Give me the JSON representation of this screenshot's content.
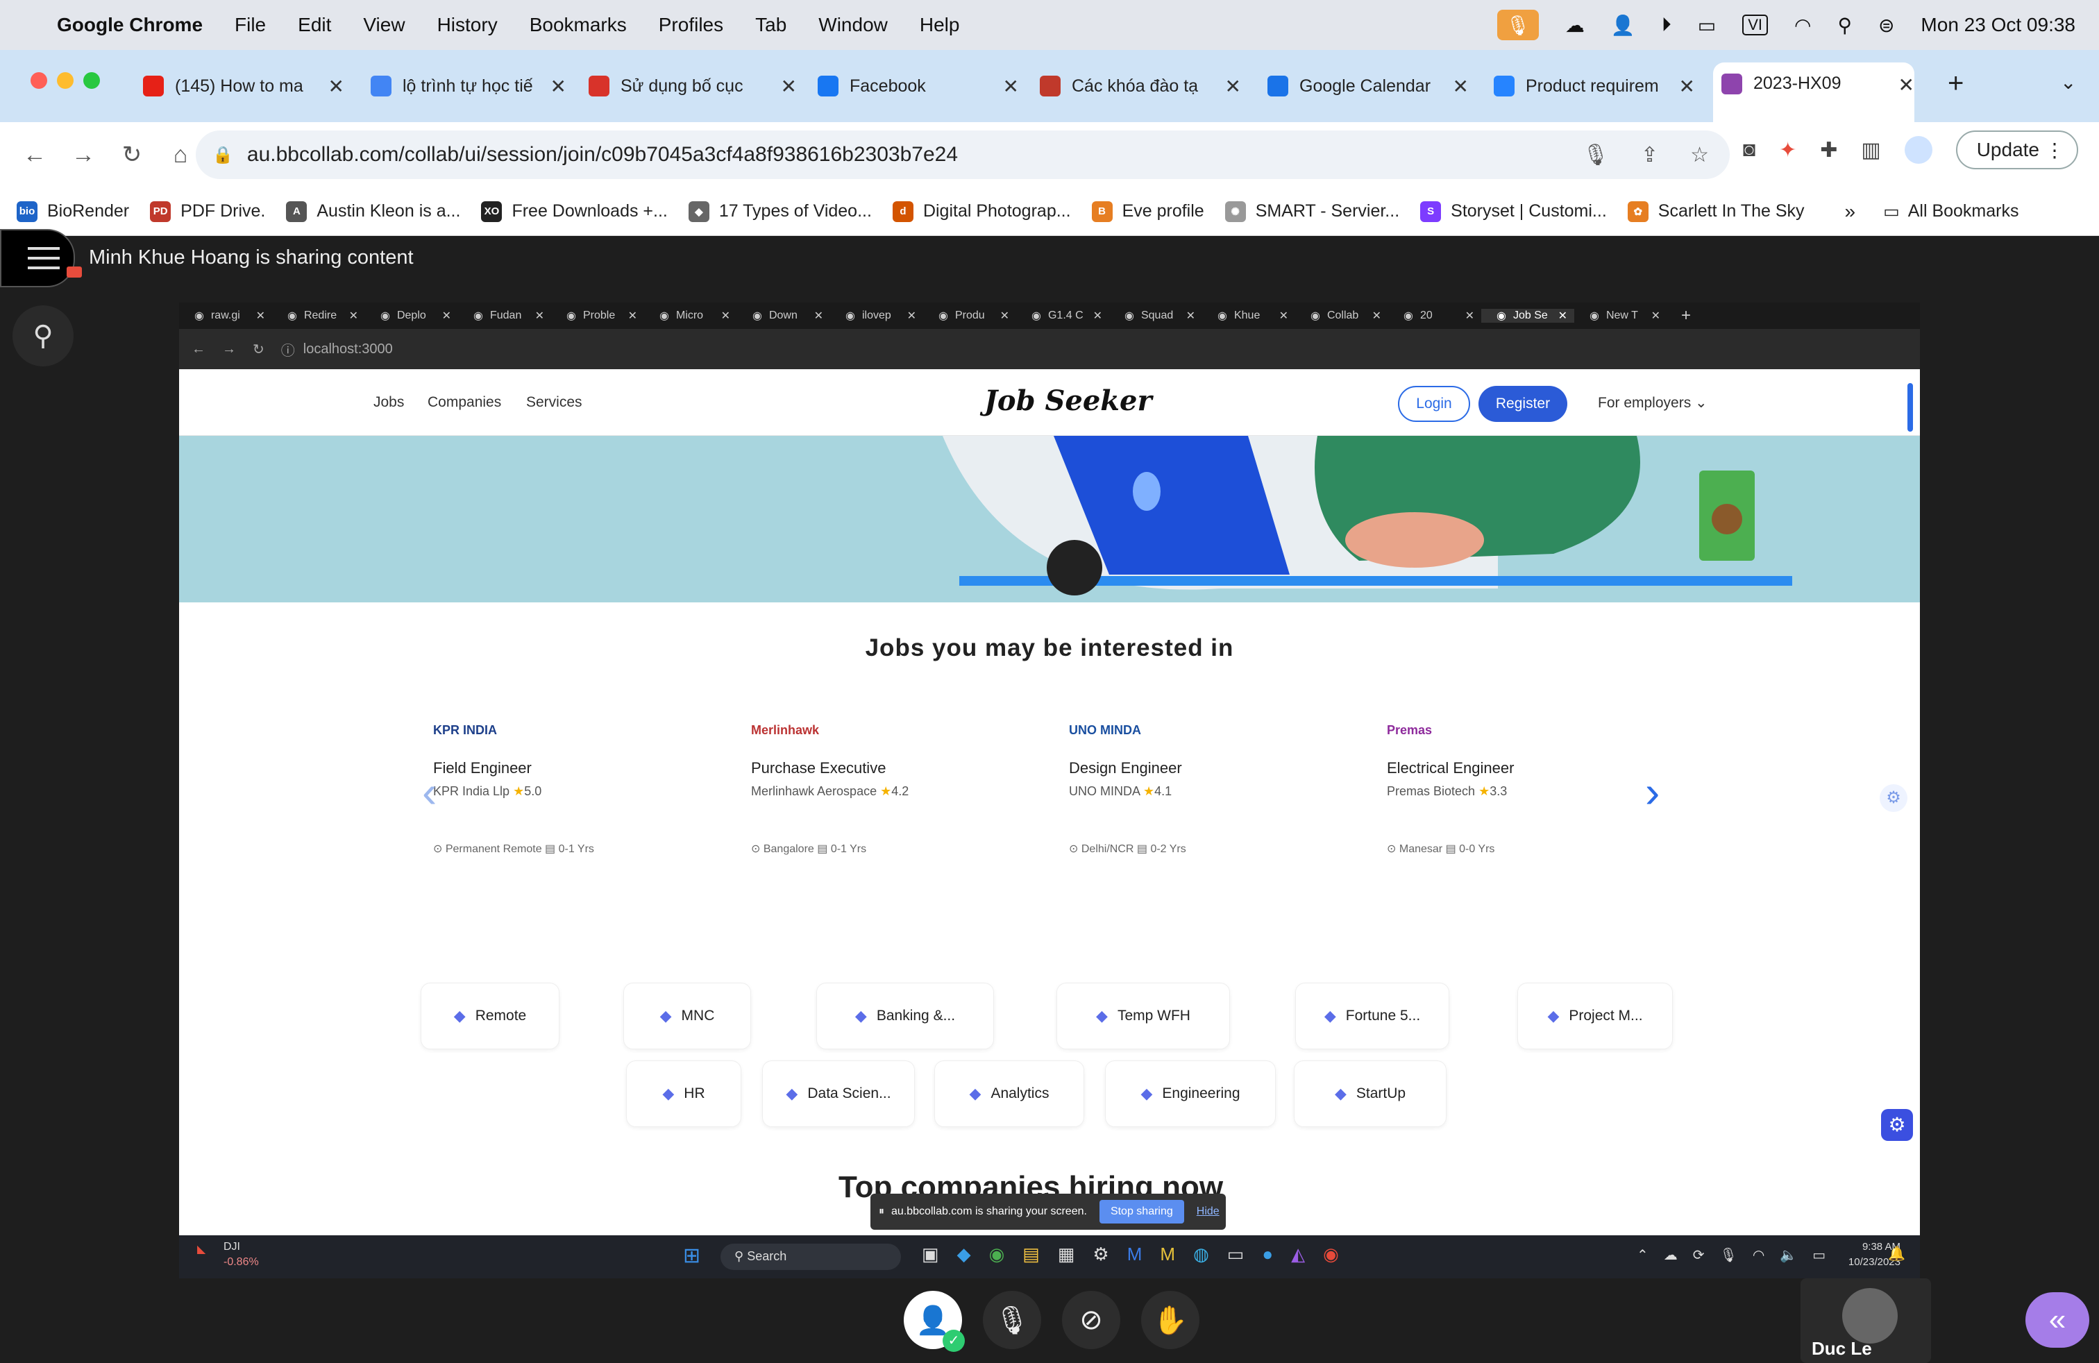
{
  "menubar": {
    "app": "Google Chrome",
    "items": [
      "File",
      "Edit",
      "View",
      "History",
      "Bookmarks",
      "Profiles",
      "Tab",
      "Window",
      "Help"
    ],
    "input_source": "VI",
    "datetime": "Mon 23 Oct  09:38"
  },
  "tabs": [
    {
      "label": "(145) How to ma",
      "icon": "youtube-icon",
      "color": "#e62117"
    },
    {
      "label": "lộ trình tự học tiế",
      "icon": "google-icon",
      "color": "#4285f4"
    },
    {
      "label": "Sử dụng bố cục",
      "icon": "t-icon",
      "color": "#d8332a"
    },
    {
      "label": "Facebook",
      "icon": "facebook-icon",
      "color": "#1877f2"
    },
    {
      "label": "Các khóa đào tạ",
      "icon": "course-icon",
      "color": "#c0392b"
    },
    {
      "label": "Google Calendar",
      "icon": "calendar-icon",
      "color": "#1a73e8"
    },
    {
      "label": "Product requirem",
      "icon": "confluence-icon",
      "color": "#2684ff"
    },
    {
      "label": "2023-HX09",
      "icon": "collab-icon",
      "color": "#8e44ad"
    }
  ],
  "toolbar": {
    "url": "au.bbcollab.com/collab/ui/session/join/c09b7045a3cf4a8f938616b2303b7e24",
    "update_label": "Update"
  },
  "bookmarks": [
    {
      "label": "BioRender",
      "color": "#1e64c8",
      "abbr": "bio"
    },
    {
      "label": "PDF Drive.",
      "color": "#c0392b",
      "abbr": "PD"
    },
    {
      "label": "Austin Kleon is a...",
      "color": "#555",
      "abbr": "A"
    },
    {
      "label": "Free Downloads +...",
      "color": "#222",
      "abbr": "XO"
    },
    {
      "label": "17 Types of Video...",
      "color": "#666",
      "abbr": "◆"
    },
    {
      "label": "Digital Photograp...",
      "color": "#d35400",
      "abbr": "d"
    },
    {
      "label": "Eve profile",
      "color": "#e67e22",
      "abbr": "B"
    },
    {
      "label": "SMART - Servier...",
      "color": "#999",
      "abbr": "✺"
    },
    {
      "label": "Storyset | Customi...",
      "color": "#7d3cff",
      "abbr": "S"
    },
    {
      "label": "Scarlett In The Sky",
      "color": "#e67e22",
      "abbr": "✿"
    }
  ],
  "bookmarks_more": "»",
  "all_bookmarks": "All Bookmarks",
  "collab": {
    "sharing_text": "Minh Khue Hoang is sharing content",
    "participant": "Duc Le"
  },
  "inner": {
    "tabs": [
      "raw.gi",
      "Redire",
      "Deplo",
      "Fudan",
      "Proble",
      "Micro",
      "Down",
      "ilovep",
      "Produ",
      "G1.4 C",
      "Squad",
      "Khue",
      "Collab",
      "20",
      "Job Se",
      "New T"
    ],
    "address": "localhost:3000",
    "nav": {
      "jobs": "Jobs",
      "companies": "Companies",
      "services": "Services",
      "logo": "Job Seeker",
      "login": "Login",
      "register": "Register",
      "employers": "For employers"
    },
    "jobs_title": "Jobs you may be interested in",
    "jobs": [
      {
        "logo": "KPR INDIA",
        "title": "Field Engineer",
        "company": "KPR India Llp",
        "rating": "5.0",
        "location": "Permanent Remote",
        "exp": "0-1 Yrs"
      },
      {
        "logo": "Merlinhawk",
        "title": "Purchase Executive",
        "company": "Merlinhawk Aerospace",
        "rating": "4.2",
        "location": "Bangalore",
        "exp": "0-1 Yrs"
      },
      {
        "logo": "UNO MINDA",
        "title": "Design Engineer",
        "company": "UNO MINDA",
        "rating": "4.1",
        "location": "Delhi/NCR",
        "exp": "0-2 Yrs"
      },
      {
        "logo": "Premas",
        "title": "Electrical Engineer",
        "company": "Premas Biotech",
        "rating": "3.3",
        "location": "Manesar",
        "exp": "0-0 Yrs"
      }
    ],
    "categories_row1": [
      "Remote",
      "MNC",
      "Banking &...",
      "Temp WFH",
      "Fortune 5...",
      "Project M..."
    ],
    "categories_row2": [
      "HR",
      "Data Scien...",
      "Analytics",
      "Engineering",
      "StartUp"
    ],
    "top_companies": "Top companies hiring now",
    "share_bar": {
      "text": "au.bbcollab.com is sharing your screen.",
      "stop": "Stop sharing",
      "hide": "Hide"
    },
    "taskbar": {
      "stock": "DJI",
      "stock_change": "-0.86%",
      "search": "Search",
      "time": "9:38 AM",
      "date": "10/23/2023"
    }
  }
}
